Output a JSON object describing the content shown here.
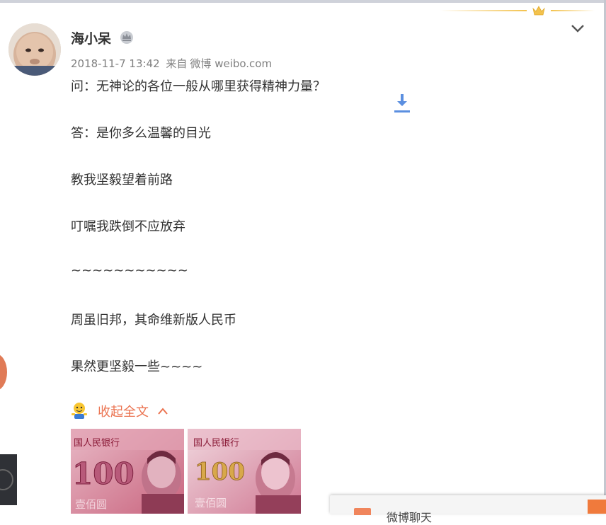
{
  "post": {
    "author": "海小呆",
    "timestamp": "2018-11-7 13:42",
    "source_prefix": "来自",
    "source": "微博 weibo.com",
    "lines": [
      "问：无神论的各位一般从哪里获得精神力量？",
      "答：是你多么温馨的目光",
      "教我坚毅望着前路",
      "叮嘱我跌倒不应放弃",
      "~~~~~~~~~~~",
      "周虽旧邦，其命维新版人民币",
      "果然更坚毅一些~~~~"
    ],
    "collapse_label": "收起全文",
    "images": [
      {
        "denomination": "100",
        "header": "国人民银行",
        "footer": "壹佰圆"
      },
      {
        "denomination": "100",
        "header": "国人民银行",
        "footer": "壹佰圆"
      }
    ]
  },
  "floating_bar": {
    "label": "微博聊天"
  },
  "icons": {
    "crown": "crown-icon",
    "badge": "vip-crown-badge-icon",
    "chevron": "chevron-down-icon",
    "download": "download-icon",
    "emoji": "doge-emoji-icon",
    "collapse": "chevron-up-icon"
  },
  "colors": {
    "accent": "#eb7350",
    "meta": "#808080",
    "text": "#333333",
    "download": "#5b8fe0",
    "crown": "#f3c24d"
  }
}
